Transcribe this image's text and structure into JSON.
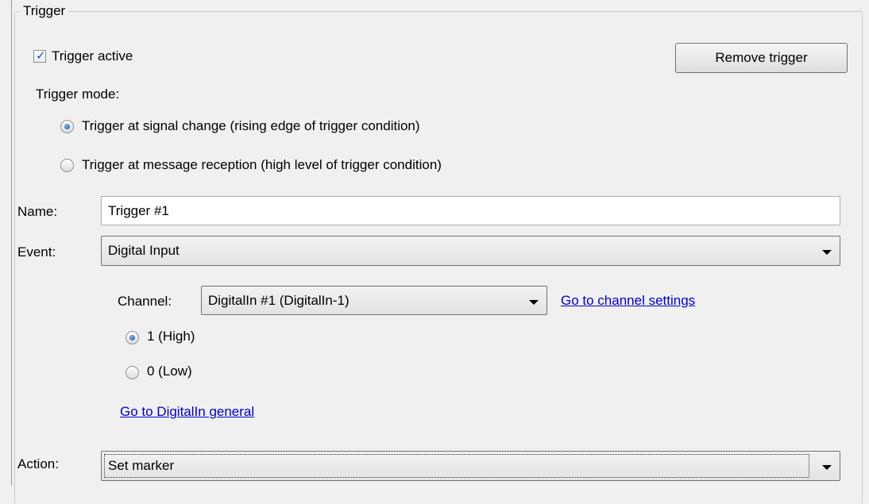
{
  "group": {
    "title": "Trigger"
  },
  "trigger_active": {
    "label": "Trigger active",
    "checked": true
  },
  "remove_button": {
    "label": "Remove trigger"
  },
  "trigger_mode": {
    "label": "Trigger mode:",
    "options": [
      {
        "label": "Trigger at signal change (rising edge of trigger condition)",
        "selected": true
      },
      {
        "label": "Trigger at message reception (high level of trigger condition)",
        "selected": false
      }
    ]
  },
  "name": {
    "label": "Name:",
    "value": "Trigger #1"
  },
  "event": {
    "label": "Event:",
    "value": "Digital Input"
  },
  "channel": {
    "label": "Channel:",
    "value": "DigitalIn #1 (DigitalIn-1)",
    "settings_link": "Go to channel settings"
  },
  "level": {
    "options": [
      {
        "label": "1 (High)",
        "selected": true
      },
      {
        "label": "0 (Low)",
        "selected": false
      }
    ]
  },
  "general_link": "Go to DigitalIn general",
  "action": {
    "label": "Action:",
    "value": "Set marker"
  },
  "icons": {
    "checkmark": "checkmark-icon",
    "dropdown": "chevron-down-icon"
  }
}
